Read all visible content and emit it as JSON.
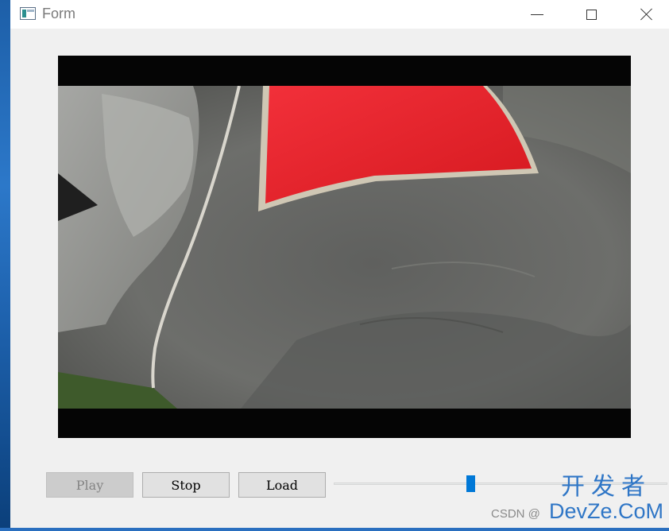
{
  "window": {
    "title": "Form",
    "icon": "app-form-icon"
  },
  "title_controls": {
    "minimize_icon": "minimize-icon",
    "maximize_icon": "maximize-icon",
    "close_icon": "close-icon"
  },
  "video": {
    "content": "video-frame-elephant",
    "colors": {
      "letterbox": "#050505",
      "blanket": "#e8232a",
      "elephant": "#6e6f6d"
    }
  },
  "controls": {
    "play_label": "Play",
    "play_enabled": false,
    "stop_label": "Stop",
    "load_label": "Load",
    "position_fraction": 0.41
  },
  "watermark": {
    "csdn": "CSDN @",
    "brand_cn": "开发者",
    "brand_en": "DevZe.CoM"
  },
  "colors": {
    "accent": "#0078d7",
    "watermark": "#2f76c6"
  }
}
